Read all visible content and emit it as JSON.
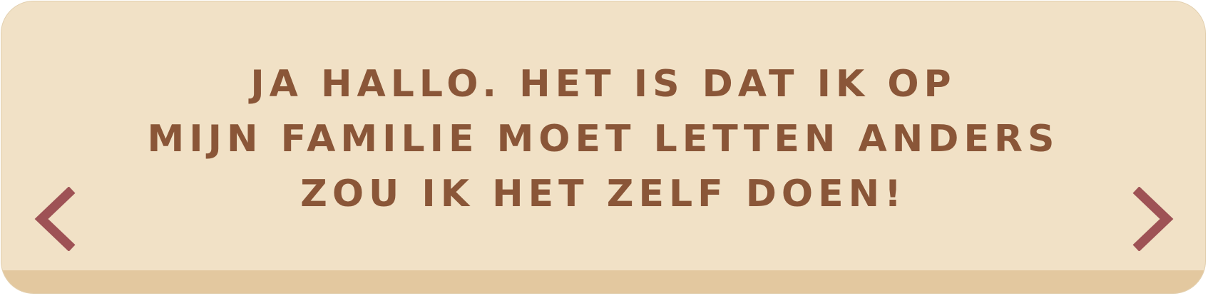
{
  "quote": {
    "lines": [
      "JA HALLO. HET IS DAT IK OP",
      "MIJN FAMILIE MOET LETTEN ANDERS",
      "ZOU IK HET ZELF DOEN!"
    ]
  },
  "navigation": {
    "prev_icon": "chevron-left-icon",
    "next_icon": "chevron-right-icon"
  },
  "colors": {
    "card_background": "#f1e1c6",
    "card_bottom_band": "#e3c89f",
    "text": "#8a5638",
    "arrow": "#9e5255"
  }
}
